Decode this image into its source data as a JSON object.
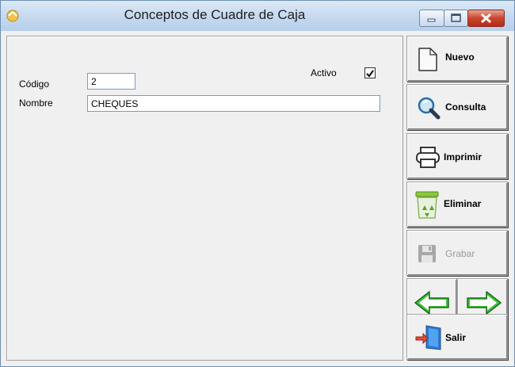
{
  "window": {
    "title": "Conceptos de Cuadre de Caja",
    "icon": "app-icon",
    "controls": [
      "minimize-icon",
      "maximize-icon",
      "close-icon"
    ]
  },
  "form": {
    "codigo_label": "Código",
    "codigo_value": "2",
    "nombre_label": "Nombre",
    "nombre_value": "CHEQUES",
    "activo_label": "Activo",
    "activo_checked": true
  },
  "toolbar": {
    "nuevo_label": "Nuevo",
    "consulta_label": "Consulta",
    "imprimir_label": "Imprimir",
    "eliminar_label": "Eliminar",
    "grabar_label": "Grabar",
    "grabar_enabled": false,
    "salir_label": "Salir"
  },
  "colors": {
    "titlebar": "#c6daf0",
    "close_button": "#c9452e",
    "arrow_green": "#3cc23a"
  }
}
